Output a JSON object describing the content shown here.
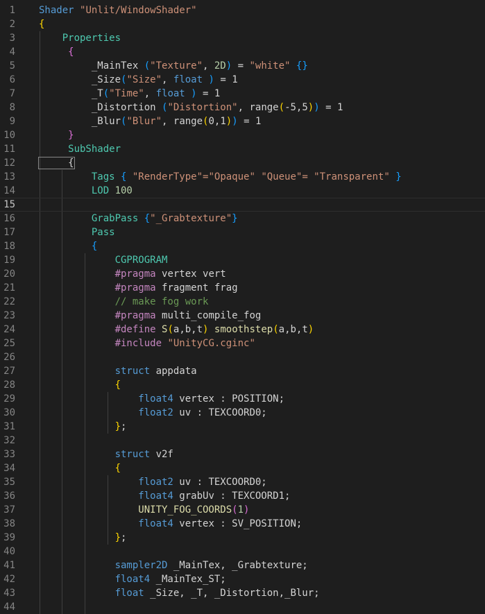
{
  "theme": {
    "background": "#1e1e1e",
    "line_number": "#858585",
    "line_number_active": "#c6c6c6"
  },
  "editor": {
    "active_line": 15,
    "lines": [
      {
        "n": "1",
        "tokens": [
          [
            "Shader ",
            "kw"
          ],
          [
            "\"Unlit/WindowShader\"",
            "str"
          ]
        ]
      },
      {
        "n": "2",
        "tokens": [
          [
            "{",
            "b1"
          ]
        ]
      },
      {
        "n": "3",
        "tokens": [
          [
            "    Properties",
            "type"
          ]
        ]
      },
      {
        "n": "4",
        "tokens": [
          [
            "     {",
            "b2"
          ]
        ]
      },
      {
        "n": "5",
        "tokens": [
          [
            "         _MainTex ",
            "id"
          ],
          [
            "(",
            "b3"
          ],
          [
            "\"Texture\"",
            "str"
          ],
          [
            ", ",
            "plain"
          ],
          [
            "2D",
            "num"
          ],
          [
            ")",
            "b3"
          ],
          [
            " = ",
            "plain"
          ],
          [
            "\"white\"",
            "str"
          ],
          [
            " {}",
            "b3"
          ]
        ]
      },
      {
        "n": "6",
        "tokens": [
          [
            "         _Size",
            "id"
          ],
          [
            "(",
            "b3"
          ],
          [
            "\"Size\"",
            "str"
          ],
          [
            ", ",
            "plain"
          ],
          [
            "float",
            "kw"
          ],
          [
            " )",
            "b3"
          ],
          [
            " = 1",
            "plain"
          ]
        ]
      },
      {
        "n": "7",
        "tokens": [
          [
            "         _T",
            "id"
          ],
          [
            "(",
            "b3"
          ],
          [
            "\"Time\"",
            "str"
          ],
          [
            ", ",
            "plain"
          ],
          [
            "float",
            "kw"
          ],
          [
            " )",
            "b3"
          ],
          [
            " = 1",
            "plain"
          ]
        ]
      },
      {
        "n": "8",
        "tokens": [
          [
            "         _Distortion ",
            "id"
          ],
          [
            "(",
            "b3"
          ],
          [
            "\"Distortion\"",
            "str"
          ],
          [
            ", range",
            "plain"
          ],
          [
            "(",
            "b1"
          ],
          [
            "-5,5",
            "plain"
          ],
          [
            ")",
            "b1"
          ],
          [
            ")",
            "b3"
          ],
          [
            " = 1",
            "plain"
          ]
        ]
      },
      {
        "n": "9",
        "tokens": [
          [
            "         _Blur",
            "id"
          ],
          [
            "(",
            "b3"
          ],
          [
            "\"Blur\"",
            "str"
          ],
          [
            ", range",
            "plain"
          ],
          [
            "(",
            "b1"
          ],
          [
            "0,1",
            "plain"
          ],
          [
            ")",
            "b1"
          ],
          [
            ")",
            "b3"
          ],
          [
            " = 1",
            "plain"
          ]
        ]
      },
      {
        "n": "10",
        "tokens": [
          [
            "     }",
            "b2"
          ]
        ]
      },
      {
        "n": "11",
        "tokens": [
          [
            "     SubShader",
            "type"
          ]
        ]
      },
      {
        "n": "12",
        "tokens": [
          [
            "     {",
            "bracketbox"
          ]
        ]
      },
      {
        "n": "13",
        "tokens": [
          [
            "         Tags ",
            "type"
          ],
          [
            "{",
            "b3"
          ],
          [
            " \"RenderType\"=\"Opaque\" \"Queue\"= \"Transparent\" ",
            "str"
          ],
          [
            "}",
            "b3"
          ]
        ]
      },
      {
        "n": "14",
        "tokens": [
          [
            "         LOD ",
            "type"
          ],
          [
            "100",
            "num"
          ]
        ]
      },
      {
        "n": "15",
        "tokens": []
      },
      {
        "n": "16",
        "tokens": [
          [
            "         GrabPass ",
            "type"
          ],
          [
            "{",
            "b3"
          ],
          [
            "\"_Grabtexture\"",
            "str"
          ],
          [
            "}",
            "b3"
          ]
        ]
      },
      {
        "n": "17",
        "tokens": [
          [
            "         Pass",
            "type"
          ]
        ]
      },
      {
        "n": "18",
        "tokens": [
          [
            "         {",
            "b3"
          ]
        ]
      },
      {
        "n": "19",
        "tokens": [
          [
            "             CGPROGRAM",
            "cg"
          ]
        ]
      },
      {
        "n": "20",
        "tokens": [
          [
            "             #pragma ",
            "pre"
          ],
          [
            "vertex vert",
            "plain"
          ]
        ]
      },
      {
        "n": "21",
        "tokens": [
          [
            "             #pragma ",
            "pre"
          ],
          [
            "fragment frag",
            "plain"
          ]
        ]
      },
      {
        "n": "22",
        "tokens": [
          [
            "             // make fog work",
            "com"
          ]
        ]
      },
      {
        "n": "23",
        "tokens": [
          [
            "             #pragma ",
            "pre"
          ],
          [
            "multi_compile_fog",
            "plain"
          ]
        ]
      },
      {
        "n": "24",
        "tokens": [
          [
            "             #define ",
            "pre"
          ],
          [
            "S",
            "fn"
          ],
          [
            "(",
            "b1"
          ],
          [
            "a,b,t",
            "plain"
          ],
          [
            ")",
            "b1"
          ],
          [
            " smoothstep",
            "fn"
          ],
          [
            "(",
            "b1"
          ],
          [
            "a,b,t",
            "plain"
          ],
          [
            ")",
            "b1"
          ]
        ]
      },
      {
        "n": "25",
        "tokens": [
          [
            "             #include ",
            "pre"
          ],
          [
            "\"UnityCG.cginc\"",
            "str"
          ]
        ]
      },
      {
        "n": "26",
        "tokens": []
      },
      {
        "n": "27",
        "tokens": [
          [
            "             struct ",
            "kw"
          ],
          [
            "appdata",
            "plain"
          ]
        ]
      },
      {
        "n": "28",
        "tokens": [
          [
            "             {",
            "b1"
          ]
        ]
      },
      {
        "n": "29",
        "tokens": [
          [
            "                 float4 ",
            "kw"
          ],
          [
            "vertex : POSITION;",
            "plain"
          ]
        ]
      },
      {
        "n": "30",
        "tokens": [
          [
            "                 float2 ",
            "kw"
          ],
          [
            "uv : TEXCOORD0;",
            "plain"
          ]
        ]
      },
      {
        "n": "31",
        "tokens": [
          [
            "             }",
            "b1"
          ],
          [
            ";",
            "plain"
          ]
        ]
      },
      {
        "n": "32",
        "tokens": []
      },
      {
        "n": "33",
        "tokens": [
          [
            "             struct ",
            "kw"
          ],
          [
            "v2f",
            "plain"
          ]
        ]
      },
      {
        "n": "34",
        "tokens": [
          [
            "             {",
            "b1"
          ]
        ]
      },
      {
        "n": "35",
        "tokens": [
          [
            "                 float2 ",
            "kw"
          ],
          [
            "uv : TEXCOORD0;",
            "plain"
          ]
        ]
      },
      {
        "n": "36",
        "tokens": [
          [
            "                 float4 ",
            "kw"
          ],
          [
            "grabUv : TEXCOORD1;",
            "plain"
          ]
        ]
      },
      {
        "n": "37",
        "tokens": [
          [
            "                 UNITY_FOG_COORDS",
            "fn"
          ],
          [
            "(",
            "b2"
          ],
          [
            "1",
            "num"
          ],
          [
            ")",
            "b2"
          ]
        ]
      },
      {
        "n": "38",
        "tokens": [
          [
            "                 float4 ",
            "kw"
          ],
          [
            "vertex : SV_POSITION;",
            "plain"
          ]
        ]
      },
      {
        "n": "39",
        "tokens": [
          [
            "             }",
            "b1"
          ],
          [
            ";",
            "plain"
          ]
        ]
      },
      {
        "n": "40",
        "tokens": []
      },
      {
        "n": "41",
        "tokens": [
          [
            "             sampler2D ",
            "kw"
          ],
          [
            "_MainTex, _Grabtexture;",
            "plain"
          ]
        ]
      },
      {
        "n": "42",
        "tokens": [
          [
            "             float4 ",
            "kw"
          ],
          [
            "_MainTex_ST;",
            "plain"
          ]
        ]
      },
      {
        "n": "43",
        "tokens": [
          [
            "             float ",
            "kw"
          ],
          [
            "_Size, _T, _Distortion,_Blur;",
            "plain"
          ]
        ]
      },
      {
        "n": "44",
        "tokens": []
      }
    ]
  }
}
